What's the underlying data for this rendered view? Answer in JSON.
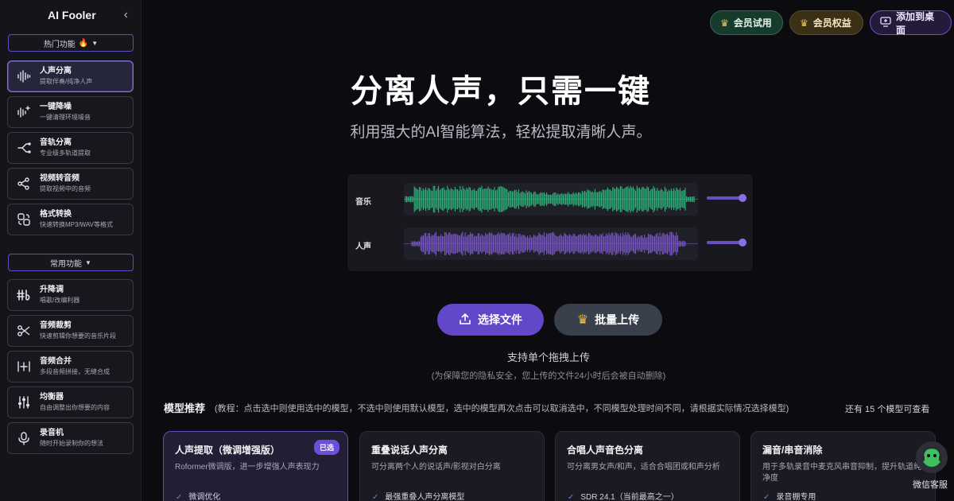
{
  "app": {
    "title": "AI Fooler",
    "collapse_icon": "chevron-left-icon"
  },
  "sidebar": {
    "hot_section": {
      "label": "热门功能",
      "emoji": "🔥"
    },
    "hot_items": [
      {
        "name": "人声分离",
        "desc": "提取伴奏/纯净人声",
        "icon": "waveform-icon",
        "active": true
      },
      {
        "name": "一键降噪",
        "desc": "一键清理环境噪音",
        "icon": "denoise-icon",
        "active": false
      },
      {
        "name": "音轨分离",
        "desc": "专业级多轨道提取",
        "icon": "split-track-icon",
        "active": false
      },
      {
        "name": "视频转音频",
        "desc": "提取视频中的音频",
        "icon": "share-nodes-icon",
        "active": false
      },
      {
        "name": "格式转换",
        "desc": "快速转换MP3/WAV等格式",
        "icon": "convert-icon",
        "active": false
      }
    ],
    "common_section": {
      "label": "常用功能"
    },
    "common_items": [
      {
        "name": "升降调",
        "desc": "唱歌/改编利器",
        "icon": "pitch-icon"
      },
      {
        "name": "音频裁剪",
        "desc": "快速剪辑你想要的音乐片段",
        "icon": "scissors-icon"
      },
      {
        "name": "音频合并",
        "desc": "多段音频拼接，无缝合成",
        "icon": "merge-icon"
      },
      {
        "name": "均衡器",
        "desc": "自由调整出你想要的内容",
        "icon": "equalizer-icon"
      },
      {
        "name": "录音机",
        "desc": "随时开始录制你的想法",
        "icon": "microphone-icon"
      }
    ]
  },
  "top_buttons": {
    "vip_trial": "会员试用",
    "vip_rights": "会员权益",
    "add_desktop": "添加到桌面"
  },
  "hero": {
    "title": "分离人声，只需一键",
    "subtitle": "利用强大的AI智能算法，轻松提取清晰人声。"
  },
  "waveform": {
    "tracks": [
      {
        "label": "音乐",
        "color": "#2fb57e",
        "volume": 1.0
      },
      {
        "label": "人声",
        "color": "#7b57c8",
        "volume": 1.0
      }
    ]
  },
  "upload": {
    "select_label": "选择文件",
    "batch_label": "批量上传",
    "drag_hint": "支持单个拖拽上传",
    "privacy_note": "(为保障您的隐私安全，您上传的文件24小时后会被自动删除)"
  },
  "models": {
    "title": "模型推荐",
    "tip": "(教程：点击选中则使用选中的模型，不选中则使用默认模型，选中的模型再次点击可以取消选中，不同模型处理时间不同，请根据实际情况选择模型)",
    "more": "还有 15 个模型可查看",
    "cards": [
      {
        "title": "人声提取（微调增强版）",
        "desc": "Roformer微调版，进一步增强人声表现力",
        "feature": "微调优化",
        "badge": "已选",
        "selected": true
      },
      {
        "title": "重叠说话人声分离",
        "desc": "可分离两个人的说话声/影视对白分离",
        "feature": "最强重叠人声分离模型",
        "badge": "",
        "selected": false
      },
      {
        "title": "合唱人声音色分离",
        "desc": "可分离男女声/和声，适合合唱团或和声分析",
        "feature": "SDR 24.1（当前最高之一）",
        "badge": "",
        "selected": false
      },
      {
        "title": "漏音/串音消除",
        "desc": "用于多轨录音中麦克风串音抑制，提升轨道纯净度",
        "feature": "录音棚专用",
        "badge": "",
        "selected": false
      }
    ]
  },
  "customer_service": {
    "label": "微信客服"
  }
}
